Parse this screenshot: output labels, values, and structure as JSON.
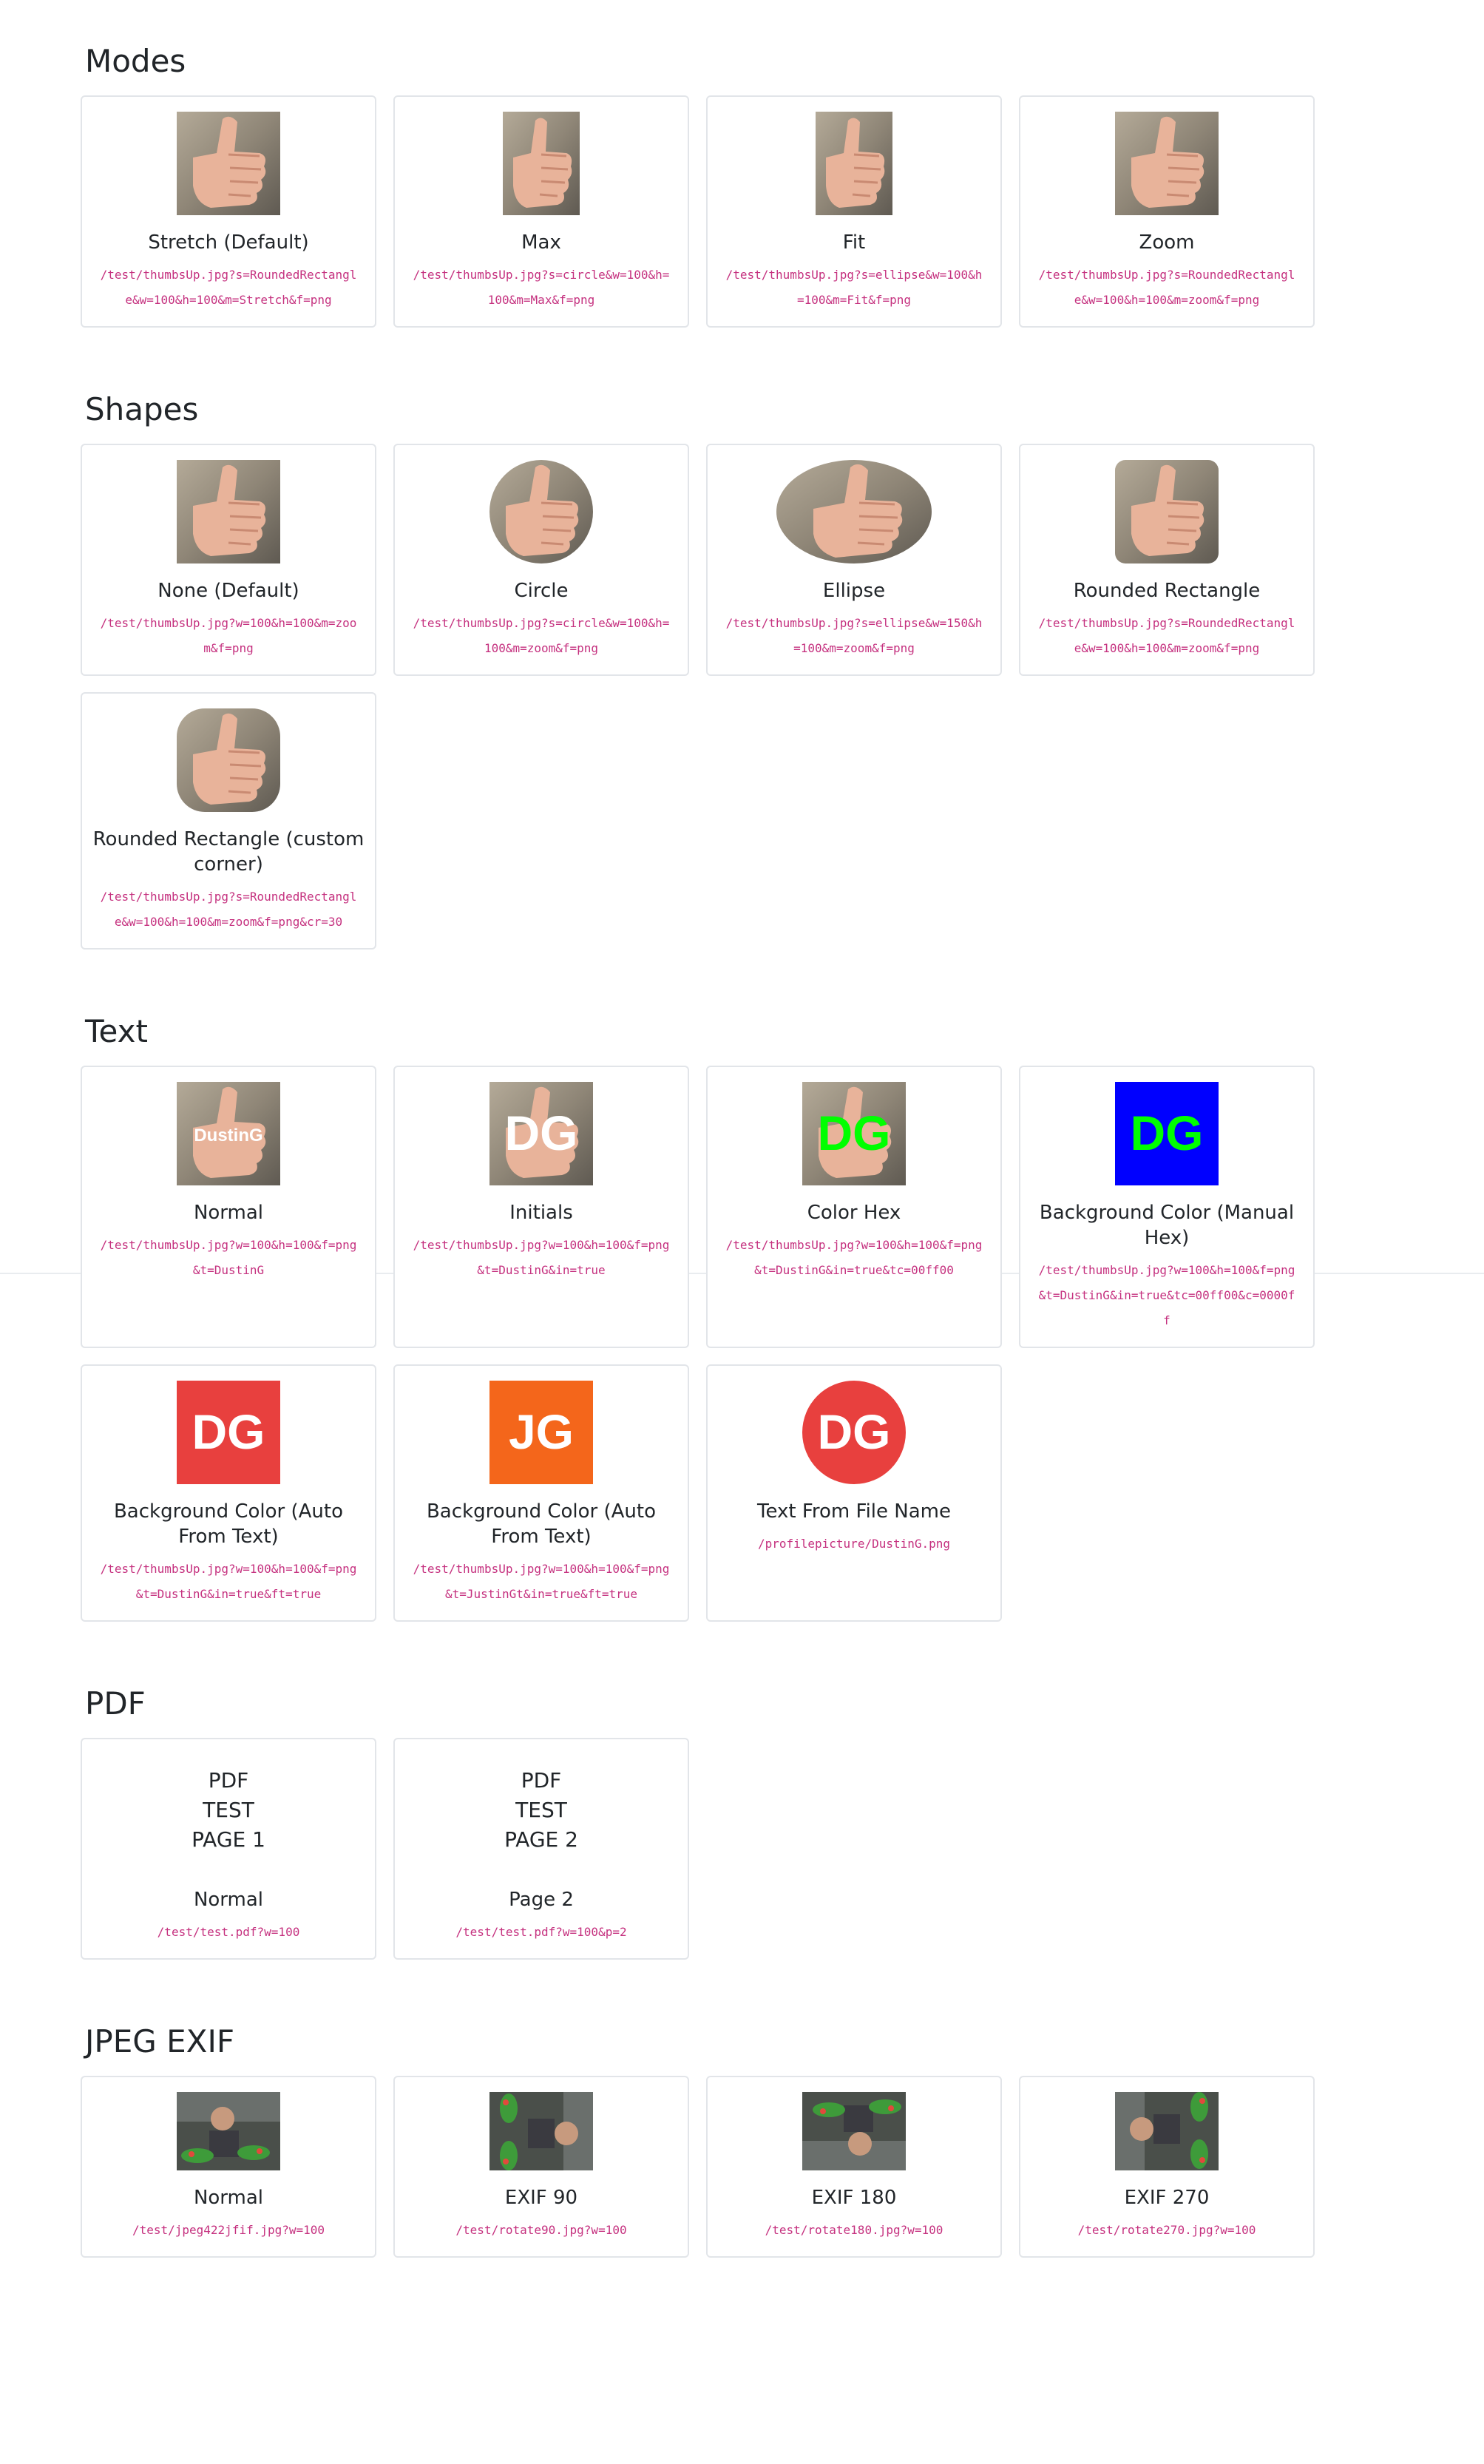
{
  "sections": {
    "modes": {
      "title": "Modes",
      "cards": [
        {
          "label": "Stretch (Default)",
          "url": "/test/thumbsUp.jpg?s=RoundedRectangle&w=100&h=100&m=Stretch&f=png"
        },
        {
          "label": "Max",
          "url": "/test/thumbsUp.jpg?s=circle&w=100&h=100&m=Max&f=png"
        },
        {
          "label": "Fit",
          "url": "/test/thumbsUp.jpg?s=ellipse&w=100&h=100&m=Fit&f=png"
        },
        {
          "label": "Zoom",
          "url": "/test/thumbsUp.jpg?s=RoundedRectangle&w=100&h=100&m=zoom&f=png"
        }
      ]
    },
    "shapes": {
      "title": "Shapes",
      "cards": [
        {
          "label": "None (Default)",
          "url": "/test/thumbsUp.jpg?w=100&h=100&m=zoom&f=png"
        },
        {
          "label": "Circle",
          "url": "/test/thumbsUp.jpg?s=circle&w=100&h=100&m=zoom&f=png"
        },
        {
          "label": "Ellipse",
          "url": "/test/thumbsUp.jpg?s=ellipse&w=150&h=100&m=zoom&f=png"
        },
        {
          "label": "Rounded Rectangle",
          "url": "/test/thumbsUp.jpg?s=RoundedRectangle&w=100&h=100&m=zoom&f=png"
        },
        {
          "label": "Rounded Rectangle (custom corner)",
          "url": "/test/thumbsUp.jpg?s=RoundedRectangle&w=100&h=100&m=zoom&f=png&cr=30"
        }
      ]
    },
    "text": {
      "title": "Text",
      "cards": [
        {
          "label": "Normal",
          "url": "/test/thumbsUp.jpg?w=100&h=100&f=png&t=DustinG",
          "overlay": "DustinG",
          "overlay_color": "#ffffff"
        },
        {
          "label": "Initials",
          "url": "/test/thumbsUp.jpg?w=100&h=100&f=png&t=DustinG&in=true",
          "overlay": "DG",
          "overlay_color": "#ffffff"
        },
        {
          "label": "Color Hex",
          "url": "/test/thumbsUp.jpg?w=100&h=100&f=png&t=DustinG&in=true&tc=00ff00",
          "overlay": "DG",
          "overlay_color": "#00ff00"
        },
        {
          "label": "Background Color (Manual Hex)",
          "url": "/test/thumbsUp.jpg?w=100&h=100&f=png&t=DustinG&in=true&tc=00ff00&c=0000ff",
          "overlay": "DG",
          "overlay_color": "#00ff00",
          "bg_color": "#0000ff"
        },
        {
          "label": "Background Color (Auto From Text)",
          "url": "/test/thumbsUp.jpg?w=100&h=100&f=png&t=DustinG&in=true&ft=true",
          "overlay": "DG",
          "overlay_color": "#ffffff",
          "bg_color": "#e8403e"
        },
        {
          "label": "Background Color (Auto From Text)",
          "url": "/test/thumbsUp.jpg?w=100&h=100&f=png&t=JustinGt&in=true&ft=true",
          "overlay": "JG",
          "overlay_color": "#ffffff",
          "bg_color": "#f4661b"
        },
        {
          "label": "Text From File Name",
          "url": "/profilepicture/DustinG.png",
          "overlay": "DG",
          "overlay_color": "#ffffff",
          "bg_color": "#e8403e"
        }
      ]
    },
    "pdf": {
      "title": "PDF",
      "cards": [
        {
          "label": "Normal",
          "url": "/test/test.pdf?w=100",
          "page_lines": [
            "PDF",
            "TEST",
            "PAGE 1"
          ]
        },
        {
          "label": "Page 2",
          "url": "/test/test.pdf?w=100&p=2",
          "page_lines": [
            "PDF",
            "TEST",
            "PAGE 2"
          ]
        }
      ]
    },
    "exif": {
      "title": "JPEG EXIF",
      "cards": [
        {
          "label": "Normal",
          "url": "/test/jpeg422jfif.jpg?w=100"
        },
        {
          "label": "EXIF 90",
          "url": "/test/rotate90.jpg?w=100"
        },
        {
          "label": "EXIF 180",
          "url": "/test/rotate180.jpg?w=100"
        },
        {
          "label": "EXIF 270",
          "url": "/test/rotate270.jpg?w=100"
        }
      ]
    }
  },
  "colors": {
    "url_text": "#c5317f",
    "card_border": "#e2e5e9"
  }
}
